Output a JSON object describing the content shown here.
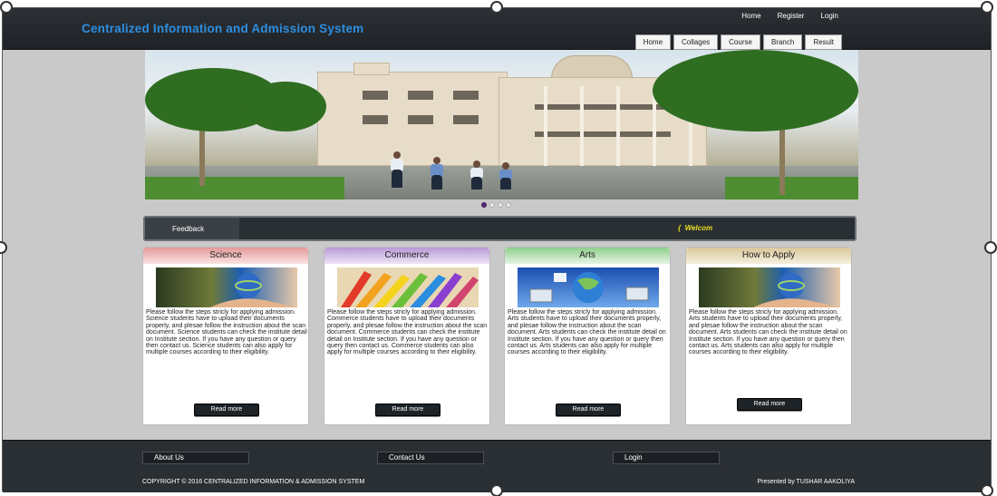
{
  "header": {
    "title": "Centralized Information and Admission System",
    "top_links": [
      "Home",
      "Register",
      "Login"
    ],
    "nav": [
      "Home",
      "Collages",
      "Course",
      "Branch",
      "Result"
    ]
  },
  "slider": {
    "dots": 4,
    "active": 1
  },
  "strip": {
    "feedback": "Feedback",
    "welcome": "Welcom"
  },
  "cards": [
    {
      "title": "Science",
      "text": "Please follow the steps stricly for applying admission. Science students have to upload their documents properly, and plesae follow the instruction about the scan document. Science students can check the institute detail on Institute section. If you have any question or query then contact us. Science students can also apply for multiple courses according to their eligibility.",
      "button": "Read more",
      "color": "#efb7b7",
      "icon": "globe-hand-image"
    },
    {
      "title": "Commerce",
      "text": "Please follow the steps stricly for applying admission. Commerce students have to upload their documents properly, and plesae follow the instruction about the scan document. Commerce students can check the institute detail on Institute section. If you have any question or query then contact us. Commerce students can also apply for multiple courses according to their eligibility.",
      "button": "Read more",
      "color": "#c9b3dc",
      "icon": "colored-pencils-image"
    },
    {
      "title": "Arts",
      "text": "Please follow the steps stricly for applying admission. Arts students have to upload their documents properly, and plesae follow the instruction about the scan document. Arts students can check the institute detail on Institute section. If you have any question or query then contact us. Arts students can also apply for multiple courses according to their eligibility.",
      "button": "Read more",
      "color": "#bfe0bd",
      "icon": "globe-computers-image"
    },
    {
      "title": "How to Apply",
      "text": "Please follow the steps stricly for applying admission. Arts students have to upload their documents properly, and plesae follow the instruction about the scan document. Arts students can check the institute detail on Institute section. If you have any question or query then contact us. Arts students can also apply for multiple courses according to their eligibility.",
      "button": "Read more",
      "color": "#e8dcbf",
      "icon": "globe-hand-image"
    }
  ],
  "footer": {
    "buttons": [
      "About Us",
      "Contact Us",
      "Login"
    ],
    "copyright": "COPYRIGHT © 2016 CENTRALIZED INFORMATION & ADMISSION SYSTEM",
    "presented": "Presented by TUSHAR AAKOLIYA"
  }
}
